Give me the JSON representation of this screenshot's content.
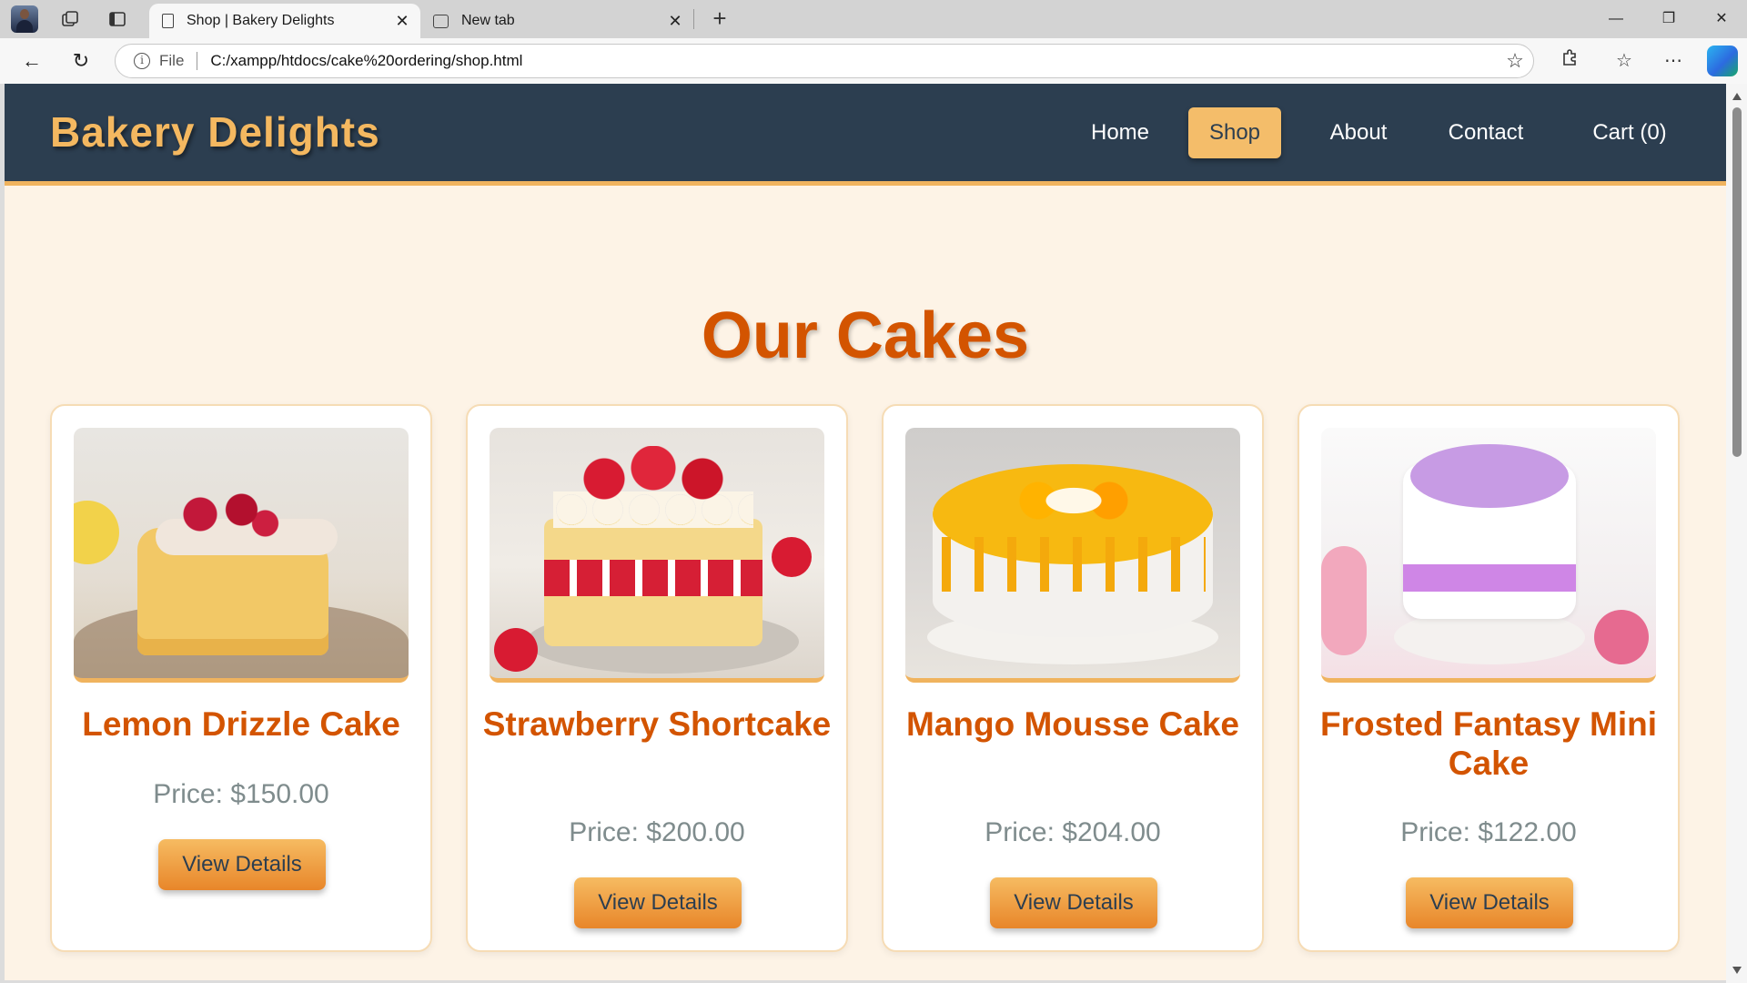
{
  "browser": {
    "tabs": [
      {
        "title": "Shop | Bakery Delights",
        "active": true
      },
      {
        "title": "New tab",
        "active": false
      }
    ],
    "url_scheme_label": "File",
    "url": "C:/xampp/htdocs/cake%20ordering/shop.html",
    "window_controls": [
      "minimize",
      "restore",
      "close"
    ]
  },
  "site": {
    "logo": "Bakery Delights",
    "nav": [
      {
        "label": "Home",
        "active": false
      },
      {
        "label": "Shop",
        "active": true
      },
      {
        "label": "About",
        "active": false
      },
      {
        "label": "Contact",
        "active": false
      },
      {
        "label": "Cart (0)",
        "active": false
      }
    ]
  },
  "page": {
    "title": "Our Cakes",
    "products": [
      {
        "name": "Lemon Drizzle Cake",
        "price": "Price: $150.00",
        "button": "View Details",
        "image_icon": "lemon-drizzle-cake-image"
      },
      {
        "name": "Strawberry Shortcake",
        "price": "Price: $200.00",
        "button": "View Details",
        "image_icon": "strawberry-shortcake-image"
      },
      {
        "name": "Mango Mousse Cake",
        "price": "Price: $204.00",
        "button": "View Details",
        "image_icon": "mango-mousse-cake-image"
      },
      {
        "name": "Frosted Fantasy Mini Cake",
        "price": "Price: $122.00",
        "button": "View Details",
        "image_icon": "frosted-fantasy-mini-cake-image"
      }
    ]
  },
  "colors": {
    "header_bg": "#2c3e50",
    "accent": "#f4bd6a",
    "title": "#d35400",
    "page_bg": "#fdf3e6",
    "price": "#7f8c8d"
  }
}
